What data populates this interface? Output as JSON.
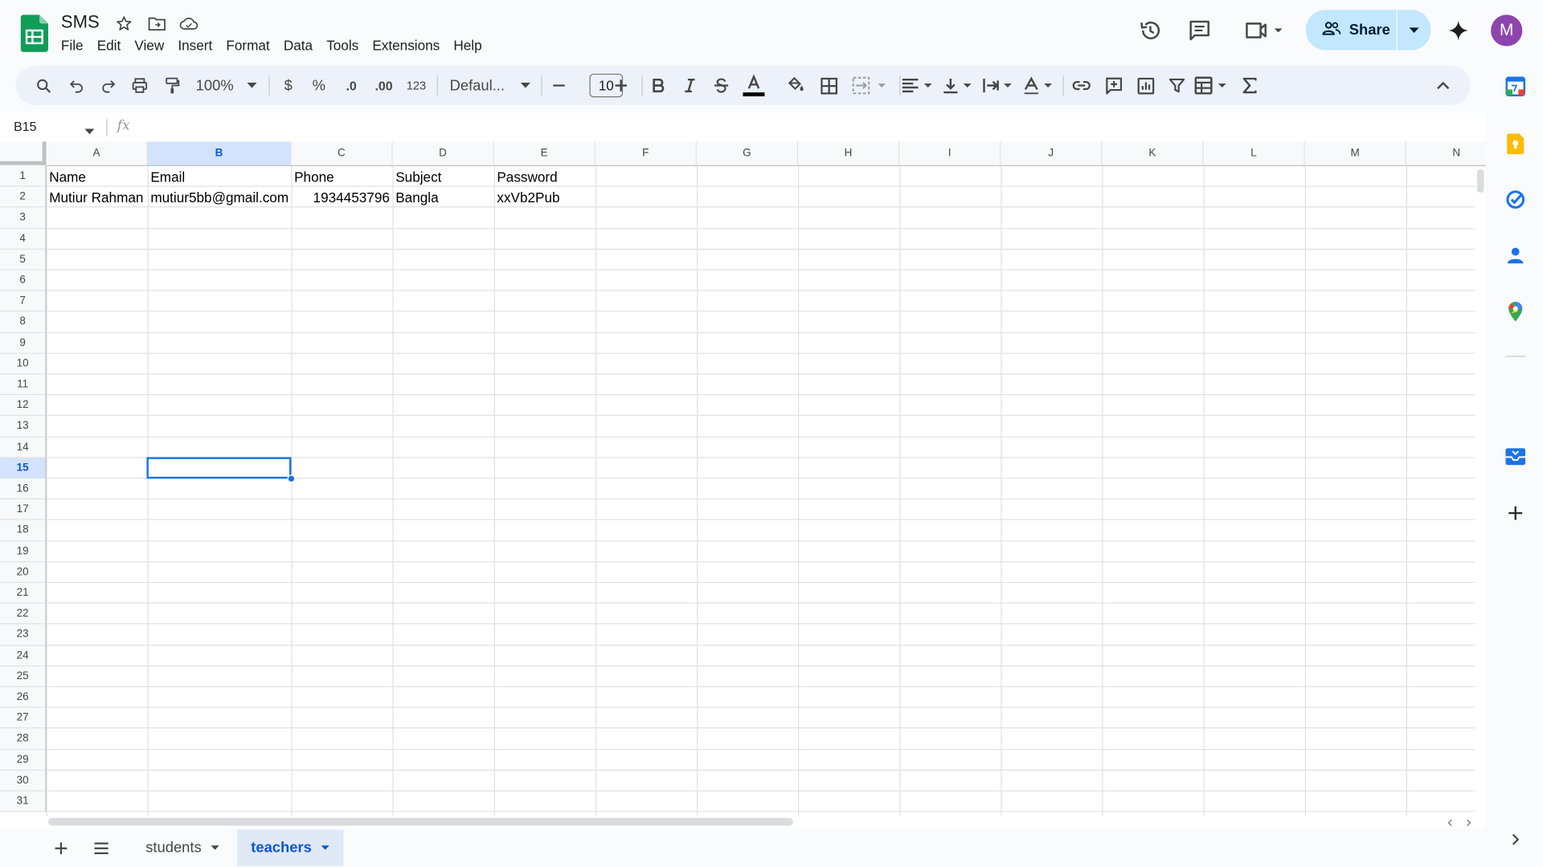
{
  "doc": {
    "title": "SMS"
  },
  "menu": [
    "File",
    "Edit",
    "View",
    "Insert",
    "Format",
    "Data",
    "Tools",
    "Extensions",
    "Help"
  ],
  "header": {
    "share_label": "Share",
    "avatar_letter": "M"
  },
  "toolbar": {
    "zoom": "100%",
    "currency": "$",
    "percent": "%",
    "decrease_decimal": ".0",
    "increase_decimal": ".00",
    "number_format": "123",
    "font": "Defaul...",
    "font_size": "10"
  },
  "formula_bar": {
    "name_box": "B15",
    "fx": "fx",
    "content": ""
  },
  "grid": {
    "columns": [
      "A",
      "B",
      "C",
      "D",
      "E",
      "F",
      "G",
      "H",
      "I",
      "J",
      "K",
      "L",
      "M",
      "N"
    ],
    "rows": [
      "1",
      "2",
      "3",
      "4",
      "5",
      "6",
      "7",
      "8",
      "9",
      "10",
      "11",
      "12",
      "13",
      "14",
      "15",
      "16",
      "17",
      "18",
      "19",
      "20",
      "21",
      "22",
      "23",
      "24",
      "25",
      "26",
      "27",
      "28",
      "29",
      "30",
      "31"
    ],
    "selected_cell": "B15",
    "cells": [
      {
        "ref": "A1",
        "value": "Name"
      },
      {
        "ref": "B1",
        "value": "Email"
      },
      {
        "ref": "C1",
        "value": "Phone"
      },
      {
        "ref": "D1",
        "value": "Subject"
      },
      {
        "ref": "E1",
        "value": "Password"
      },
      {
        "ref": "A2",
        "value": "Mutiur Rahman"
      },
      {
        "ref": "B2",
        "value": "mutiur5bb@gmail.com"
      },
      {
        "ref": "C2",
        "value": "1934453796"
      },
      {
        "ref": "D2",
        "value": "Bangla"
      },
      {
        "ref": "E2",
        "value": "xxVb2Pub"
      }
    ]
  },
  "sheets": {
    "tabs": [
      "students",
      "teachers"
    ],
    "active": "teachers"
  },
  "colors": {
    "accent": "#1a73e8",
    "share_bg": "#c2e7ff",
    "sheets_green": "#0f9d58",
    "avatar": "#8e44ad"
  }
}
